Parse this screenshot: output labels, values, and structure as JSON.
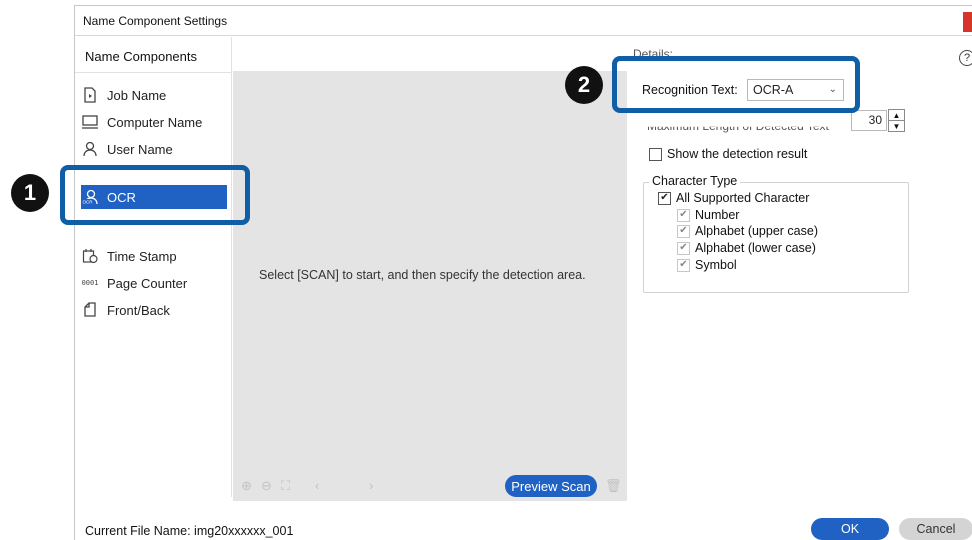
{
  "window": {
    "title": "Name Component Settings"
  },
  "left_pane": {
    "header": "Name Components",
    "items": [
      {
        "label": "Job Name",
        "icon": "job-icon"
      },
      {
        "label": "Computer Name",
        "icon": "computer-icon"
      },
      {
        "label": "User Name",
        "icon": "user-icon"
      },
      {
        "label": "OCR",
        "icon": "ocr-icon",
        "selected": true
      },
      {
        "label": "Time Stamp",
        "icon": "calendar-icon"
      },
      {
        "label": "Page Counter",
        "icon": "counter-icon"
      },
      {
        "label": "Front/Back",
        "icon": "page-icon"
      }
    ]
  },
  "preview": {
    "message": "Select [SCAN] to start, and then specify the detection area.",
    "preview_scan_label": "Preview Scan"
  },
  "details": {
    "label": "Details:",
    "recognition_label": "Recognition Text:",
    "recognition_value": "OCR-A",
    "partial_row_label": "Maximum Length of Detected Text",
    "max_length_value": "30",
    "show_detection_label": "Show the detection result",
    "show_detection_checked": false,
    "character_type_title": "Character Type",
    "all_supported_label": "All Supported Character",
    "all_supported_checked": true,
    "sub_options": [
      {
        "label": "Number",
        "checked": true
      },
      {
        "label": "Alphabet (upper case)",
        "checked": true
      },
      {
        "label": "Alphabet (lower case)",
        "checked": true
      },
      {
        "label": "Symbol",
        "checked": true
      }
    ]
  },
  "footer": {
    "current_file_label": "Current File Name: img20xxxxxx_001",
    "ok_label": "OK",
    "cancel_label": "Cancel"
  },
  "callouts": [
    {
      "number": "1"
    },
    {
      "number": "2"
    }
  ],
  "colors": {
    "accent": "#1f62c4",
    "callout": "#0f5ea6",
    "close": "#d9342b"
  }
}
